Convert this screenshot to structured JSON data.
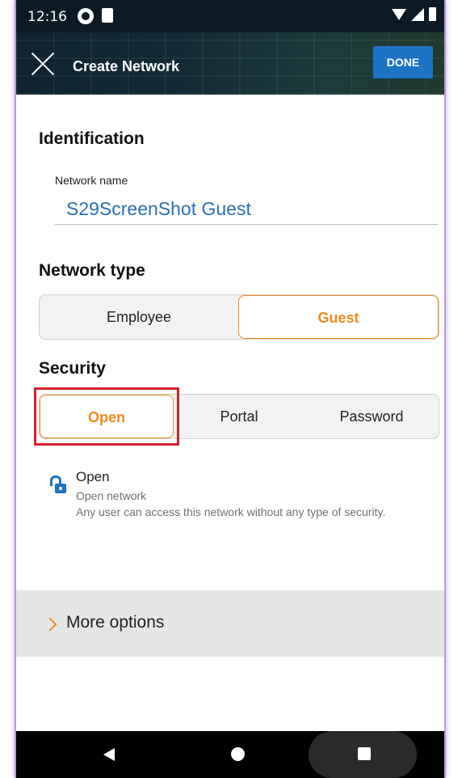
{
  "status_bar": {
    "time": "12:16"
  },
  "app_bar": {
    "title": "Create Network",
    "done_label": "DONE"
  },
  "identification": {
    "heading": "Identification",
    "network_name_label": "Network name",
    "network_name_value": "S29ScreenShot Guest"
  },
  "network_type": {
    "heading": "Network type",
    "options": [
      "Employee",
      "Guest"
    ],
    "selected": "Guest"
  },
  "security": {
    "heading": "Security",
    "options": [
      "Open",
      "Portal",
      "Password"
    ],
    "selected": "Open",
    "detail": {
      "icon": "unlock-icon",
      "title": "Open",
      "subtitle": "Open network",
      "description": "Any user can access this network without any type of security."
    }
  },
  "more_options": {
    "label": "More options"
  },
  "colors": {
    "accent": "#f08a1c",
    "primary": "#1d73c4",
    "highlight": "#d41f2e"
  }
}
